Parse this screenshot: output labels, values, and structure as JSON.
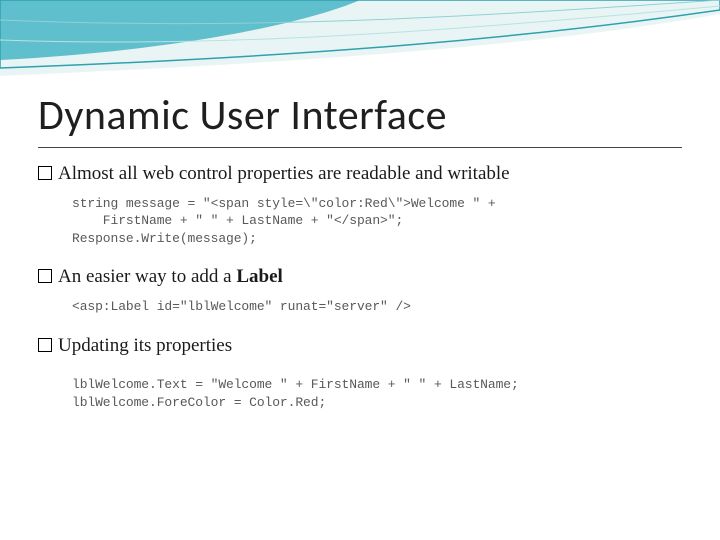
{
  "title": "Dynamic User Interface",
  "bullets": {
    "b1": "Almost all web control properties are readable and writable",
    "b2_prefix": "An easier way to add a ",
    "b2_bold": "Label",
    "b3": "Updating its properties"
  },
  "code": {
    "c1": "string message = \"<span style=\\\"color:Red\\\">Welcome \" +\n    FirstName + \" \" + LastName + \"</span>\";\nResponse.Write(message);",
    "c2": "<asp:Label id=\"lblWelcome\" runat=\"server\" />",
    "c3": "lblWelcome.Text = \"Welcome \" + FirstName + \" \" + LastName;\nlblWelcome.ForeColor = Color.Red;"
  }
}
